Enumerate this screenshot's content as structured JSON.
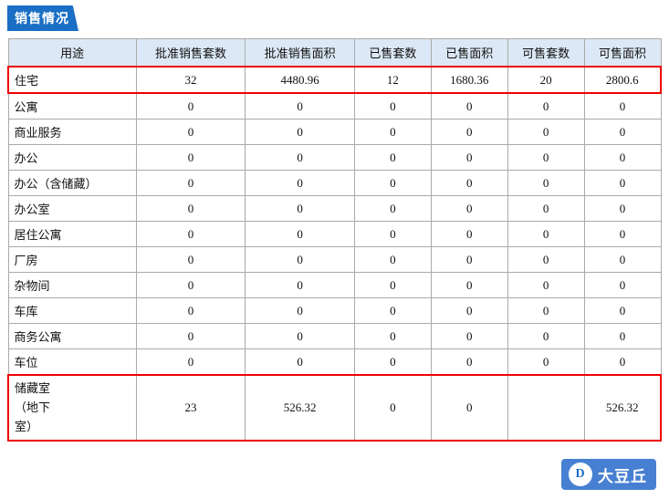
{
  "title": "销售情况",
  "watermark": {
    "icon": "D",
    "text": "大豆丘"
  },
  "table": {
    "headers": [
      "用途",
      "批准销售套数",
      "批准销售面积",
      "已售套数",
      "已售面积",
      "可售套数",
      "可售面积"
    ],
    "rows": [
      {
        "name": "住宅",
        "highlight": true,
        "cols": [
          "32",
          "4480.96",
          "12",
          "1680.36",
          "20",
          "2800.6"
        ]
      },
      {
        "name": "公寓",
        "highlight": false,
        "cols": [
          "0",
          "0",
          "0",
          "0",
          "0",
          "0"
        ]
      },
      {
        "name": "商业服务",
        "highlight": false,
        "cols": [
          "0",
          "0",
          "0",
          "0",
          "0",
          "0"
        ]
      },
      {
        "name": "办公",
        "highlight": false,
        "cols": [
          "0",
          "0",
          "0",
          "0",
          "0",
          "0"
        ]
      },
      {
        "name": "办公（含储藏）",
        "highlight": false,
        "cols": [
          "0",
          "0",
          "0",
          "0",
          "0",
          "0"
        ]
      },
      {
        "name": "办公室",
        "highlight": false,
        "cols": [
          "0",
          "0",
          "0",
          "0",
          "0",
          "0"
        ]
      },
      {
        "name": "居住公寓",
        "highlight": false,
        "cols": [
          "0",
          "0",
          "0",
          "0",
          "0",
          "0"
        ]
      },
      {
        "name": "厂房",
        "highlight": false,
        "cols": [
          "0",
          "0",
          "0",
          "0",
          "0",
          "0"
        ]
      },
      {
        "name": "杂物间",
        "highlight": false,
        "cols": [
          "0",
          "0",
          "0",
          "0",
          "0",
          "0"
        ]
      },
      {
        "name": "车库",
        "highlight": false,
        "cols": [
          "0",
          "0",
          "0",
          "0",
          "0",
          "0"
        ]
      },
      {
        "name": "商务公寓",
        "highlight": false,
        "cols": [
          "0",
          "0",
          "0",
          "0",
          "0",
          "0"
        ]
      },
      {
        "name": "车位",
        "highlight": false,
        "cols": [
          "0",
          "0",
          "0",
          "0",
          "0",
          "0"
        ]
      }
    ],
    "storage_row": {
      "name": "储藏室（地下室）",
      "highlight": true,
      "cols": [
        "23",
        "526.32",
        "0",
        "0",
        "",
        "526.32"
      ]
    }
  }
}
